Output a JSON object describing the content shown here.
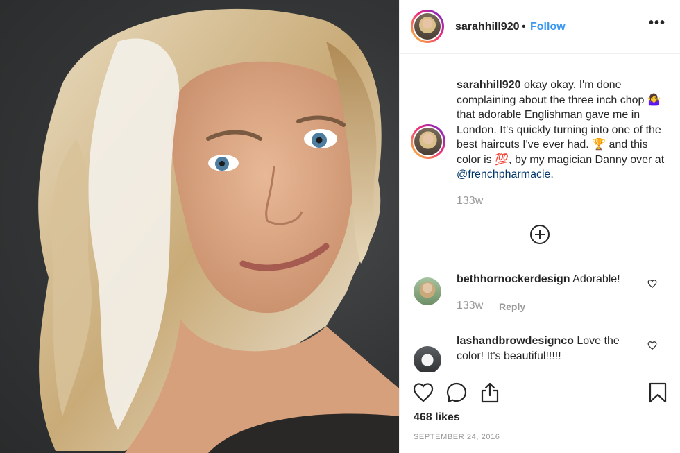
{
  "photo": {
    "alt_icon": "post-photo"
  },
  "header": {
    "username": "sarahhill920",
    "separator": "•",
    "follow_label": "Follow",
    "more_label": "•••"
  },
  "caption": {
    "username": "sarahhill920",
    "text_1": "okay okay. I'm done complaining about the three inch chop 🤷‍♀️ that adorable Englishman gave me in London. It's quickly turning into one of the best haircuts I've ever had. 🏆 and this color is 💯, by my magician Danny over at ",
    "mention": "@frenchpharmacie",
    "text_2": ".",
    "time": "133w"
  },
  "comments": [
    {
      "username": "bethhornockerdesign",
      "text": "Adorable!",
      "time": "133w",
      "reply_label": "Reply"
    },
    {
      "username": "lashandbrowdesignco",
      "text": "Love the color! It's beautiful!!!!!"
    }
  ],
  "footer": {
    "likes": "468 likes",
    "date": "September 24, 2016"
  },
  "colors": {
    "link": "#3897f0",
    "mention": "#003569",
    "muted": "#999999",
    "text": "#262626"
  }
}
